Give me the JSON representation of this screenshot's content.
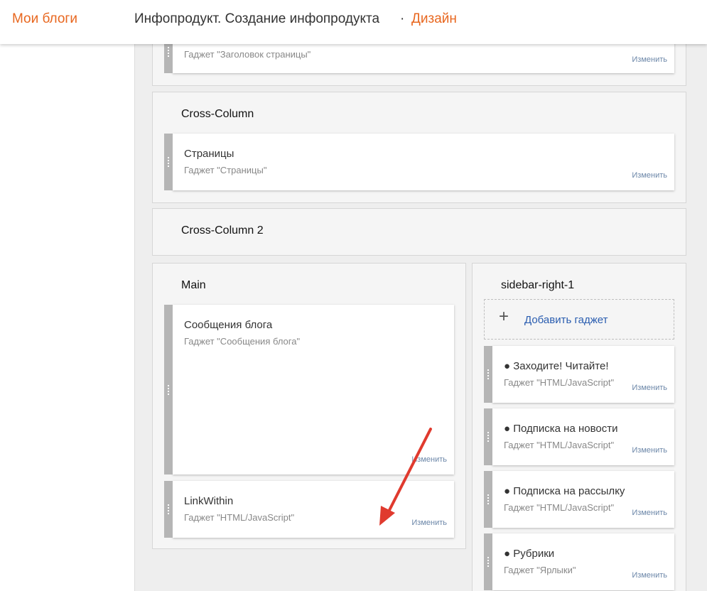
{
  "header": {
    "my_blogs": "Мои блоги",
    "blog_title": "Инфопродукт. Создание инфопродукта",
    "separator": "·",
    "section": "Дизайн"
  },
  "edit_label": "Изменить",
  "top_gadget": {
    "subtitle": "Гаджет \"Заголовок страницы\""
  },
  "cross_column": {
    "title": "Cross-Column",
    "gadget": {
      "title": "Страницы",
      "subtitle": "Гаджет \"Страницы\""
    }
  },
  "cross_column_2": {
    "title": "Cross-Column 2"
  },
  "main": {
    "title": "Main",
    "gadgets": [
      {
        "title": "Сообщения блога",
        "subtitle": "Гаджет \"Сообщения блога\""
      },
      {
        "title": "LinkWithin",
        "subtitle": "Гаджет \"HTML/JavaScript\""
      }
    ]
  },
  "sidebar": {
    "title": "sidebar-right-1",
    "add_gadget": "Добавить гаджет",
    "gadgets": [
      {
        "title": "● Заходите! Читайте!",
        "subtitle": "Гаджет \"HTML/JavaScript\""
      },
      {
        "title": "● Подписка на новости",
        "subtitle": "Гаджет \"HTML/JavaScript\""
      },
      {
        "title": "● Подписка на рассылку",
        "subtitle": "Гаджет \"HTML/JavaScript\""
      },
      {
        "title": "● Рубрики",
        "subtitle": "Гаджет \"Ярлыки\""
      }
    ]
  },
  "colors": {
    "accent": "#e8671f",
    "link": "#2a5db0",
    "annotation_arrow": "#e03a2e"
  }
}
